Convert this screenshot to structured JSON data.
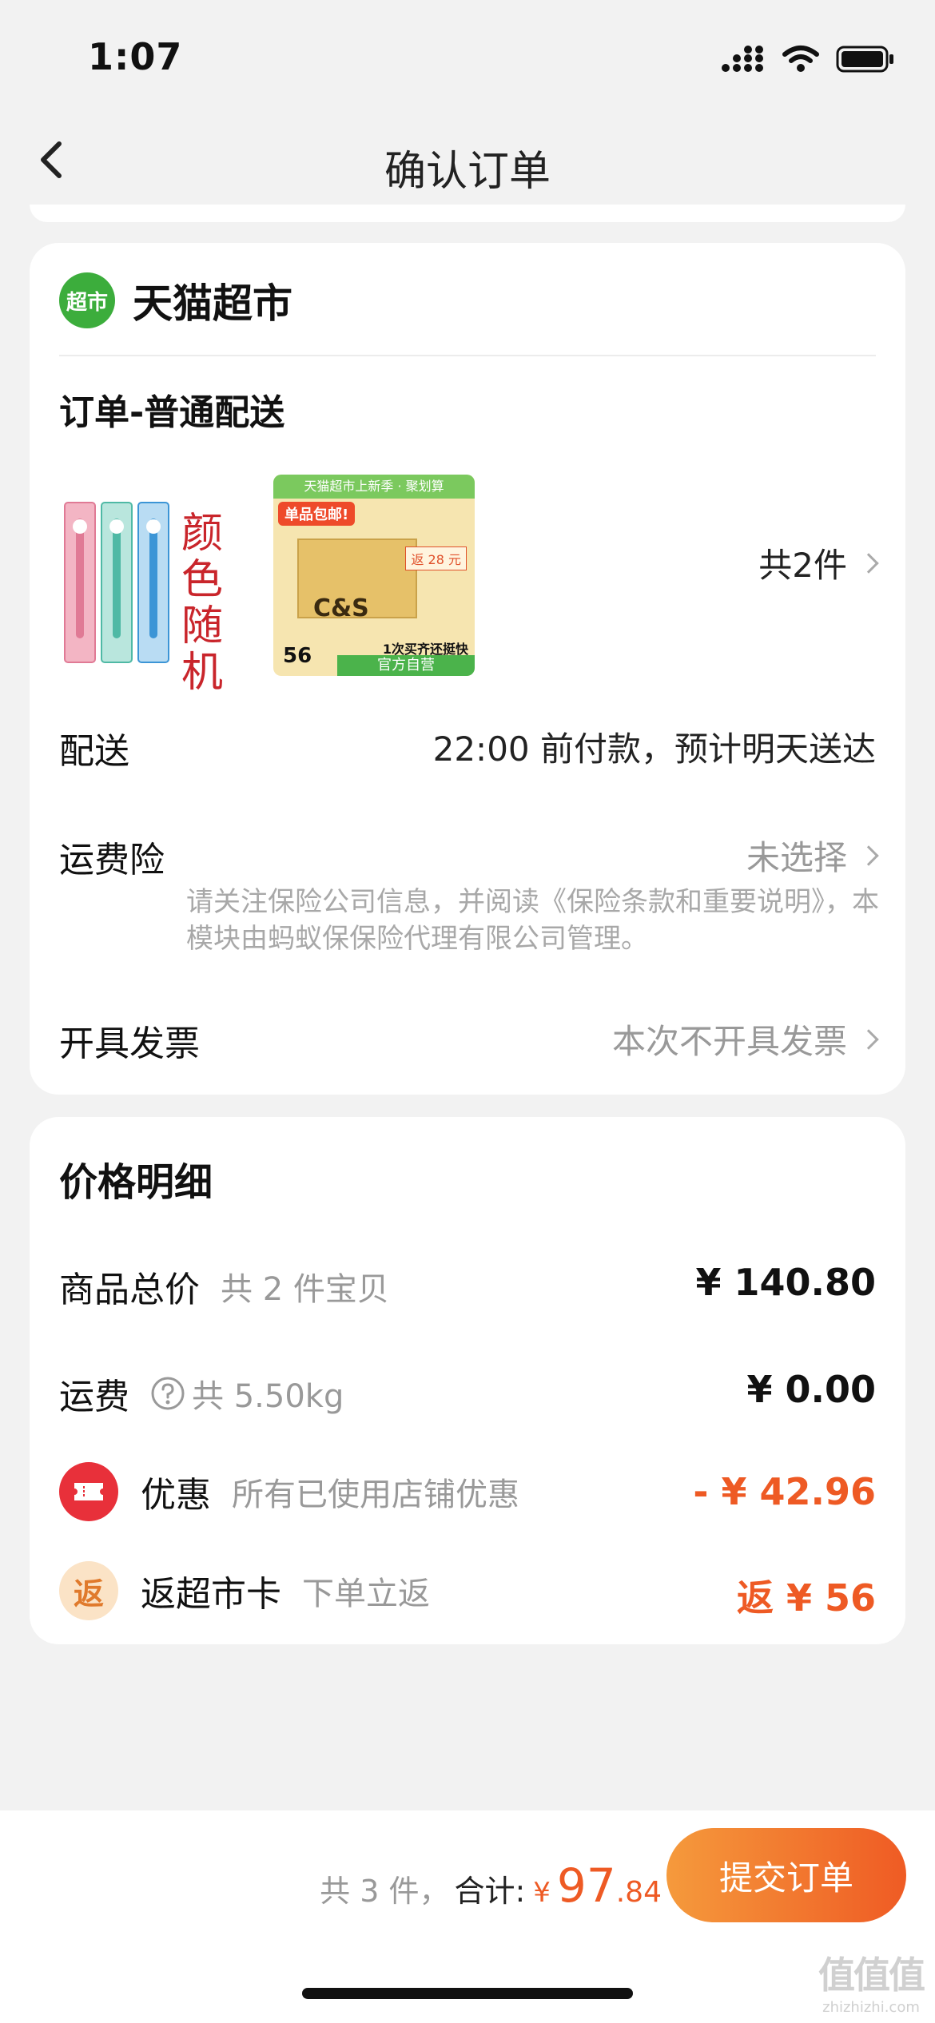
{
  "status": {
    "time": "1:07"
  },
  "nav": {
    "title": "确认订单"
  },
  "store": {
    "logo_text": "超市",
    "name": "天猫超市"
  },
  "order": {
    "section_title": "订单-普通配送",
    "toothbrush_label": "颜色随机",
    "tissue_banner": "天猫超市上新季 · 聚划算",
    "tissue_badge": "单品包邮!",
    "tissue_brand": "C&S",
    "tissue_rebate": "返 28 元",
    "tissue_price": "56",
    "tissue_bottom": "官方自营",
    "tissue_promo": "1次买齐还挺快",
    "count_text": "共2件"
  },
  "delivery": {
    "label": "配送",
    "value": "22:00 前付款，预计明天送达"
  },
  "insurance": {
    "label": "运费险",
    "value": "未选择",
    "note": "请关注保险公司信息，并阅读《保险条款和重要说明》，本模块由蚂蚁保保险代理有限公司管理。"
  },
  "invoice": {
    "label": "开具发票",
    "value": "本次不开具发票"
  },
  "price": {
    "title": "价格明细",
    "goods_label": "商品总价",
    "goods_sub": "共 2 件宝贝",
    "goods_value": "¥ 140.80",
    "shipping_label": "运费",
    "shipping_sub": "共 5.50kg",
    "shipping_value": "¥ 0.00",
    "discount_label": "优惠",
    "discount_sub": "所有已使用店铺优惠",
    "discount_value": "- ¥ 42.96",
    "rebate_icon": "返",
    "rebate_label": "返超市卡",
    "rebate_sub": "下单立返",
    "rebate_value": "返 ¥ 56"
  },
  "footer": {
    "count": "共 3 件，",
    "total_label": "合计:",
    "currency": "¥",
    "total_int": "97",
    "total_dec": ".84",
    "submit": "提交订单"
  },
  "watermark": {
    "glyphs": "值值值",
    "site": "zhizhizhi.com"
  },
  "colors": {
    "accent": "#ee5a24",
    "green": "#3cad3c",
    "muted": "#999999"
  }
}
